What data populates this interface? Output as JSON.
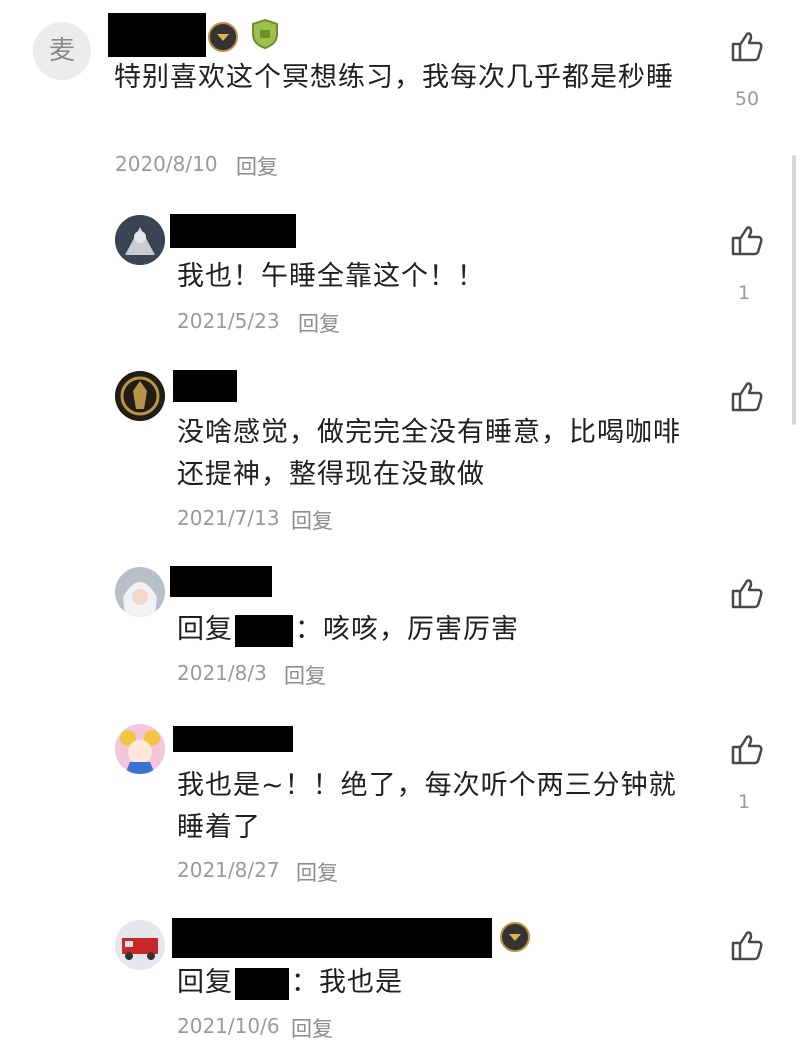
{
  "comments": [
    {
      "avatar_char": "麦",
      "text": "特别喜欢这个冥想练习，我每次几乎都是秒睡",
      "date": "2020/8/10",
      "reply_label": "回复",
      "likes": "50"
    },
    {
      "text": "我也！午睡全靠这个！！",
      "date": "2021/5/23",
      "reply_label": "回复",
      "likes": "1"
    },
    {
      "text": "没啥感觉，做完完全没有睡意，比喝咖啡还提神，整得现在没敢做",
      "date": "2021/7/13",
      "reply_label": "回复",
      "likes": ""
    },
    {
      "text_prefix": "回复",
      "text_suffix": "：咳咳，厉害厉害",
      "date": "2021/8/3",
      "reply_label": "回复",
      "likes": ""
    },
    {
      "text": "我也是~！！绝了，每次听个两三分钟就睡着了",
      "date": "2021/8/27",
      "reply_label": "回复",
      "likes": "1"
    },
    {
      "text_prefix": "回复",
      "text_suffix": "：我也是",
      "date": "2021/10/6",
      "reply_label": "回复",
      "likes": ""
    }
  ],
  "icons": {
    "like": "thumbs-up-outline-icon",
    "badge": "gold-level-badge-icon",
    "shield": "green-shield-badge-icon"
  },
  "colors": {
    "meta": "#9a9a9a",
    "text": "#202020",
    "redaction": "#000000"
  }
}
